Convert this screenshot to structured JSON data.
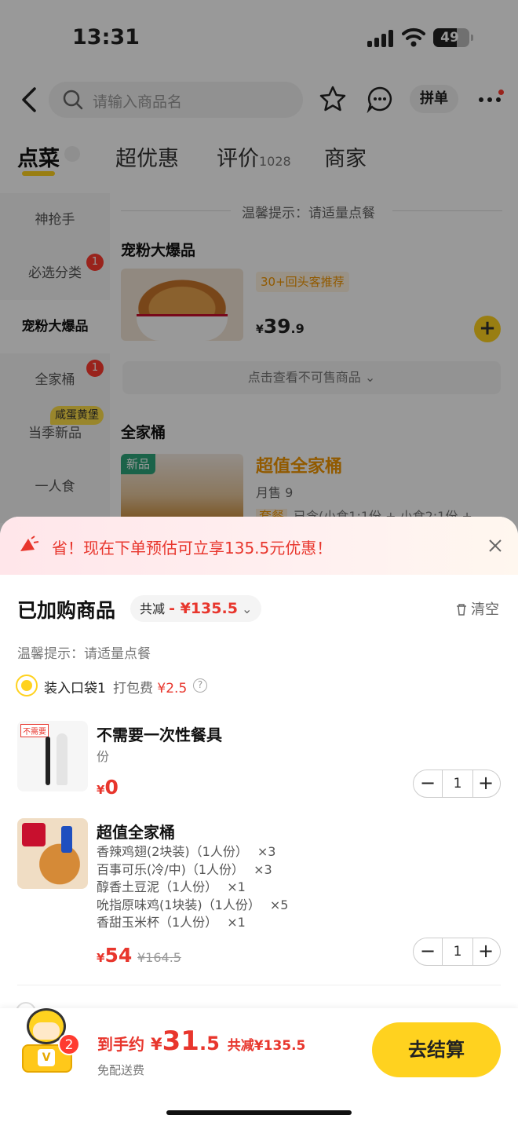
{
  "status": {
    "time": "13:31",
    "battery": "49"
  },
  "search": {
    "placeholder": "请输入商品名"
  },
  "header": {
    "group_label": "拼单"
  },
  "tabs": [
    {
      "label": "点菜"
    },
    {
      "label": "超优惠"
    },
    {
      "label": "评价",
      "count": "1028"
    },
    {
      "label": "商家"
    }
  ],
  "sidebar": {
    "items": [
      {
        "label": "神抢手"
      },
      {
        "label": "必选分类",
        "badge": "1"
      },
      {
        "label": "宠粉大爆品"
      },
      {
        "label": "全家桶",
        "badge": "1"
      },
      {
        "label": "当季新品",
        "tag": "咸蛋黄堡"
      },
      {
        "label": "一人食"
      }
    ]
  },
  "menu": {
    "tip": "温馨提示：请适量点餐",
    "section1": "宠粉大爆品",
    "item1": {
      "tag": "30+回头客推荐",
      "currency": "¥",
      "price_int": "39",
      "price_dec": ".9"
    },
    "unavailable": "点击查看不可售商品 ⌄",
    "section2": "全家桶",
    "item2": {
      "new_tag": "新品",
      "title": "超值全家桶",
      "sold": "月售 9",
      "set_tag": "套餐",
      "set_desc": "已含(小食1:1份 + 小食2:1份 +"
    }
  },
  "promo": {
    "text": "省！现在下单预估可立享135.5元优惠！"
  },
  "cart": {
    "title": "已加购商品",
    "saving_label": "共减",
    "saving_value": "- ¥135.5",
    "clear": "清空",
    "tip": "温馨提示：请适量点餐",
    "bag": {
      "label": "装入口袋1",
      "fee_label": "打包费",
      "fee_value": "¥2.5"
    },
    "items": [
      {
        "img_tag": "不需要",
        "name": "不需要一次性餐具",
        "unit": "份",
        "currency": "¥",
        "price": "0",
        "qty": "1"
      },
      {
        "name": "超值全家桶",
        "details": [
          {
            "text": "香辣鸡翅(2块装)（1人份）",
            "count": "×3"
          },
          {
            "text": "百事可乐(冷/中)（1人份）",
            "count": "×3"
          },
          {
            "text": "醇香土豆泥（1人份）",
            "count": "×1"
          },
          {
            "text": "吮指原味鸡(1块装)（1人份）",
            "count": "×5"
          },
          {
            "text": "香甜玉米杯（1人份）",
            "count": "×1"
          }
        ],
        "currency": "¥",
        "price": "54",
        "original_price": "¥164.5",
        "qty": "1"
      }
    ]
  },
  "bottom": {
    "cart_count": "2",
    "total_label": "到手约",
    "currency": "¥",
    "total_int": "31",
    "total_dec": ".5",
    "saving": "共减¥135.5",
    "delivery": "免配送费",
    "checkout": "去结算"
  },
  "colors": {
    "accent": "#ffd21f",
    "price": "#e8362d",
    "orange": "#f29600"
  }
}
